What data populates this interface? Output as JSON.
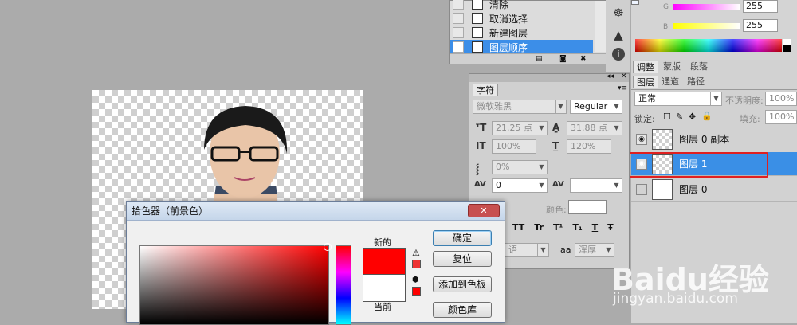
{
  "history": {
    "items": [
      {
        "label": "清除"
      },
      {
        "label": "取消选择"
      },
      {
        "label": "新建图层"
      },
      {
        "label": "图层顺序"
      }
    ]
  },
  "color_panel": {
    "g_label": "G",
    "g_value": "255",
    "b_label": "B",
    "b_value": "255"
  },
  "panel_tabs": {
    "top": [
      "调整",
      "蒙版",
      "段落"
    ],
    "layers": [
      "图层",
      "通道",
      "路径"
    ]
  },
  "layers": {
    "blend_mode": "正常",
    "opacity_label": "不透明度:",
    "opacity_value": "100%",
    "lock_label": "锁定:",
    "fill_label": "填充:",
    "fill_value": "100%",
    "items": [
      {
        "name": "图层 0 副本"
      },
      {
        "name": "图层 1"
      },
      {
        "name": "图层 0"
      }
    ]
  },
  "character": {
    "title": "字符",
    "font_family": "微软雅黑",
    "font_style": "Regular",
    "font_size": "21.25 点",
    "leading": "31.88 点",
    "vscale": "100%",
    "hscale": "120%",
    "baseline": "0%",
    "kerning": "0",
    "color_label": "颜色:",
    "lang": "语",
    "aa_label": "aa",
    "aa_value": "浑厚",
    "style_buttons": [
      "TT",
      "Tr",
      "T¹",
      "T₁",
      "T",
      "Ŧ"
    ]
  },
  "dialog": {
    "title": "拾色器（前景色）",
    "new_label": "新的",
    "current_label": "当前",
    "buttons": [
      "确定",
      "复位",
      "添加到色板",
      "颜色库"
    ],
    "new_color": "#ff0000",
    "current_color": "#ffffff"
  },
  "watermark": {
    "brand": "Baidu经验",
    "url": "jingyan.baidu.com"
  }
}
